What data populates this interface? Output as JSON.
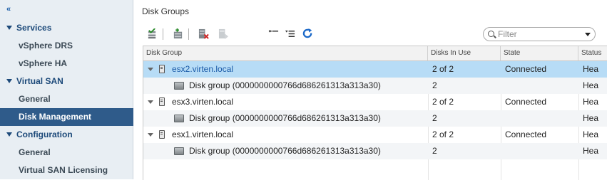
{
  "sidebar": {
    "collapse_glyph": "«",
    "items": [
      {
        "label": "Services",
        "type": "header",
        "icon": "triangle-down-icon"
      },
      {
        "label": "vSphere DRS",
        "type": "child"
      },
      {
        "label": "vSphere HA",
        "type": "child"
      },
      {
        "label": "Virtual SAN",
        "type": "header",
        "icon": "triangle-down-icon"
      },
      {
        "label": "General",
        "type": "child"
      },
      {
        "label": "Disk Management",
        "type": "child",
        "selected": true
      },
      {
        "label": "Configuration",
        "type": "header",
        "icon": "triangle-down-icon"
      },
      {
        "label": "General",
        "type": "child"
      },
      {
        "label": "Virtual SAN Licensing",
        "type": "child"
      }
    ]
  },
  "main": {
    "title": "Disk Groups",
    "toolbar": {
      "icons": [
        "claim-disks-icon",
        "create-disk-group-icon",
        "remove-disk-group-icon",
        "add-disk-icon",
        "collapse-all-icon",
        "expand-all-icon",
        "refresh-icon"
      ]
    },
    "filter": {
      "placeholder": "Filter",
      "value": ""
    },
    "table": {
      "columns": [
        "Disk Group",
        "Disks In Use",
        "State",
        "Status"
      ],
      "rows": [
        {
          "kind": "host",
          "name": "esx2.virten.local",
          "disks": "2 of 2",
          "state": "Connected",
          "status": "Hea",
          "selected": true
        },
        {
          "kind": "group",
          "name": "Disk group (0000000000766d686261313a313a30)",
          "disks": "2",
          "state": "",
          "status": "Hea"
        },
        {
          "kind": "host",
          "name": "esx3.virten.local",
          "disks": "2 of 2",
          "state": "Connected",
          "status": "Hea"
        },
        {
          "kind": "group",
          "name": "Disk group (0000000000766d686261313a313a30)",
          "disks": "2",
          "state": "",
          "status": "Hea"
        },
        {
          "kind": "host",
          "name": "esx1.virten.local",
          "disks": "2 of 2",
          "state": "Connected",
          "status": "Hea"
        },
        {
          "kind": "group",
          "name": "Disk group (0000000000766d686261313a313a30)",
          "disks": "2",
          "state": "",
          "status": "Hea"
        }
      ]
    }
  },
  "colors": {
    "sidebar_bg": "#e8eef3",
    "sidebar_selected": "#2f5b8a",
    "row_selected": "#b7dcf6",
    "link": "#1a5aa8"
  }
}
